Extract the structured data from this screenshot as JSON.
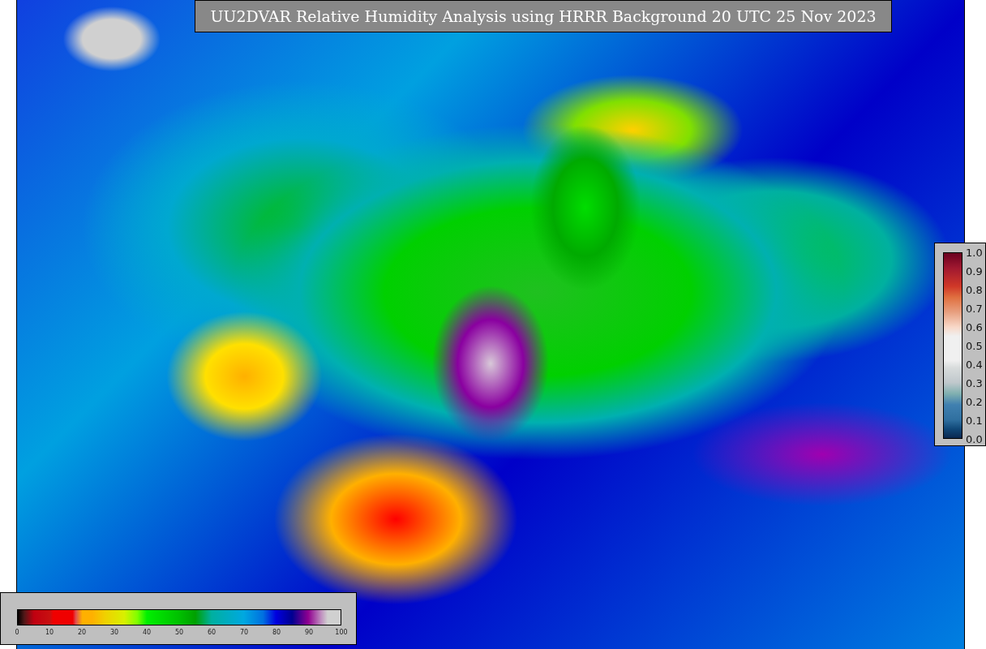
{
  "title": "UU2DVAR Relative Humidity Analysis using HRRR Background 20 UTC 25 Nov 2023",
  "station_colorbar": {
    "tick_labels": [
      "1.0",
      "0.9",
      "0.8",
      "0.7",
      "0.6",
      "0.5",
      "0.4",
      "0.3",
      "0.2",
      "0.1",
      "0.0"
    ]
  },
  "humidity_colorbar": {
    "tick_labels": [
      "0",
      "10",
      "20",
      "30",
      "40",
      "50",
      "60",
      "70",
      "80",
      "90",
      "100"
    ]
  }
}
